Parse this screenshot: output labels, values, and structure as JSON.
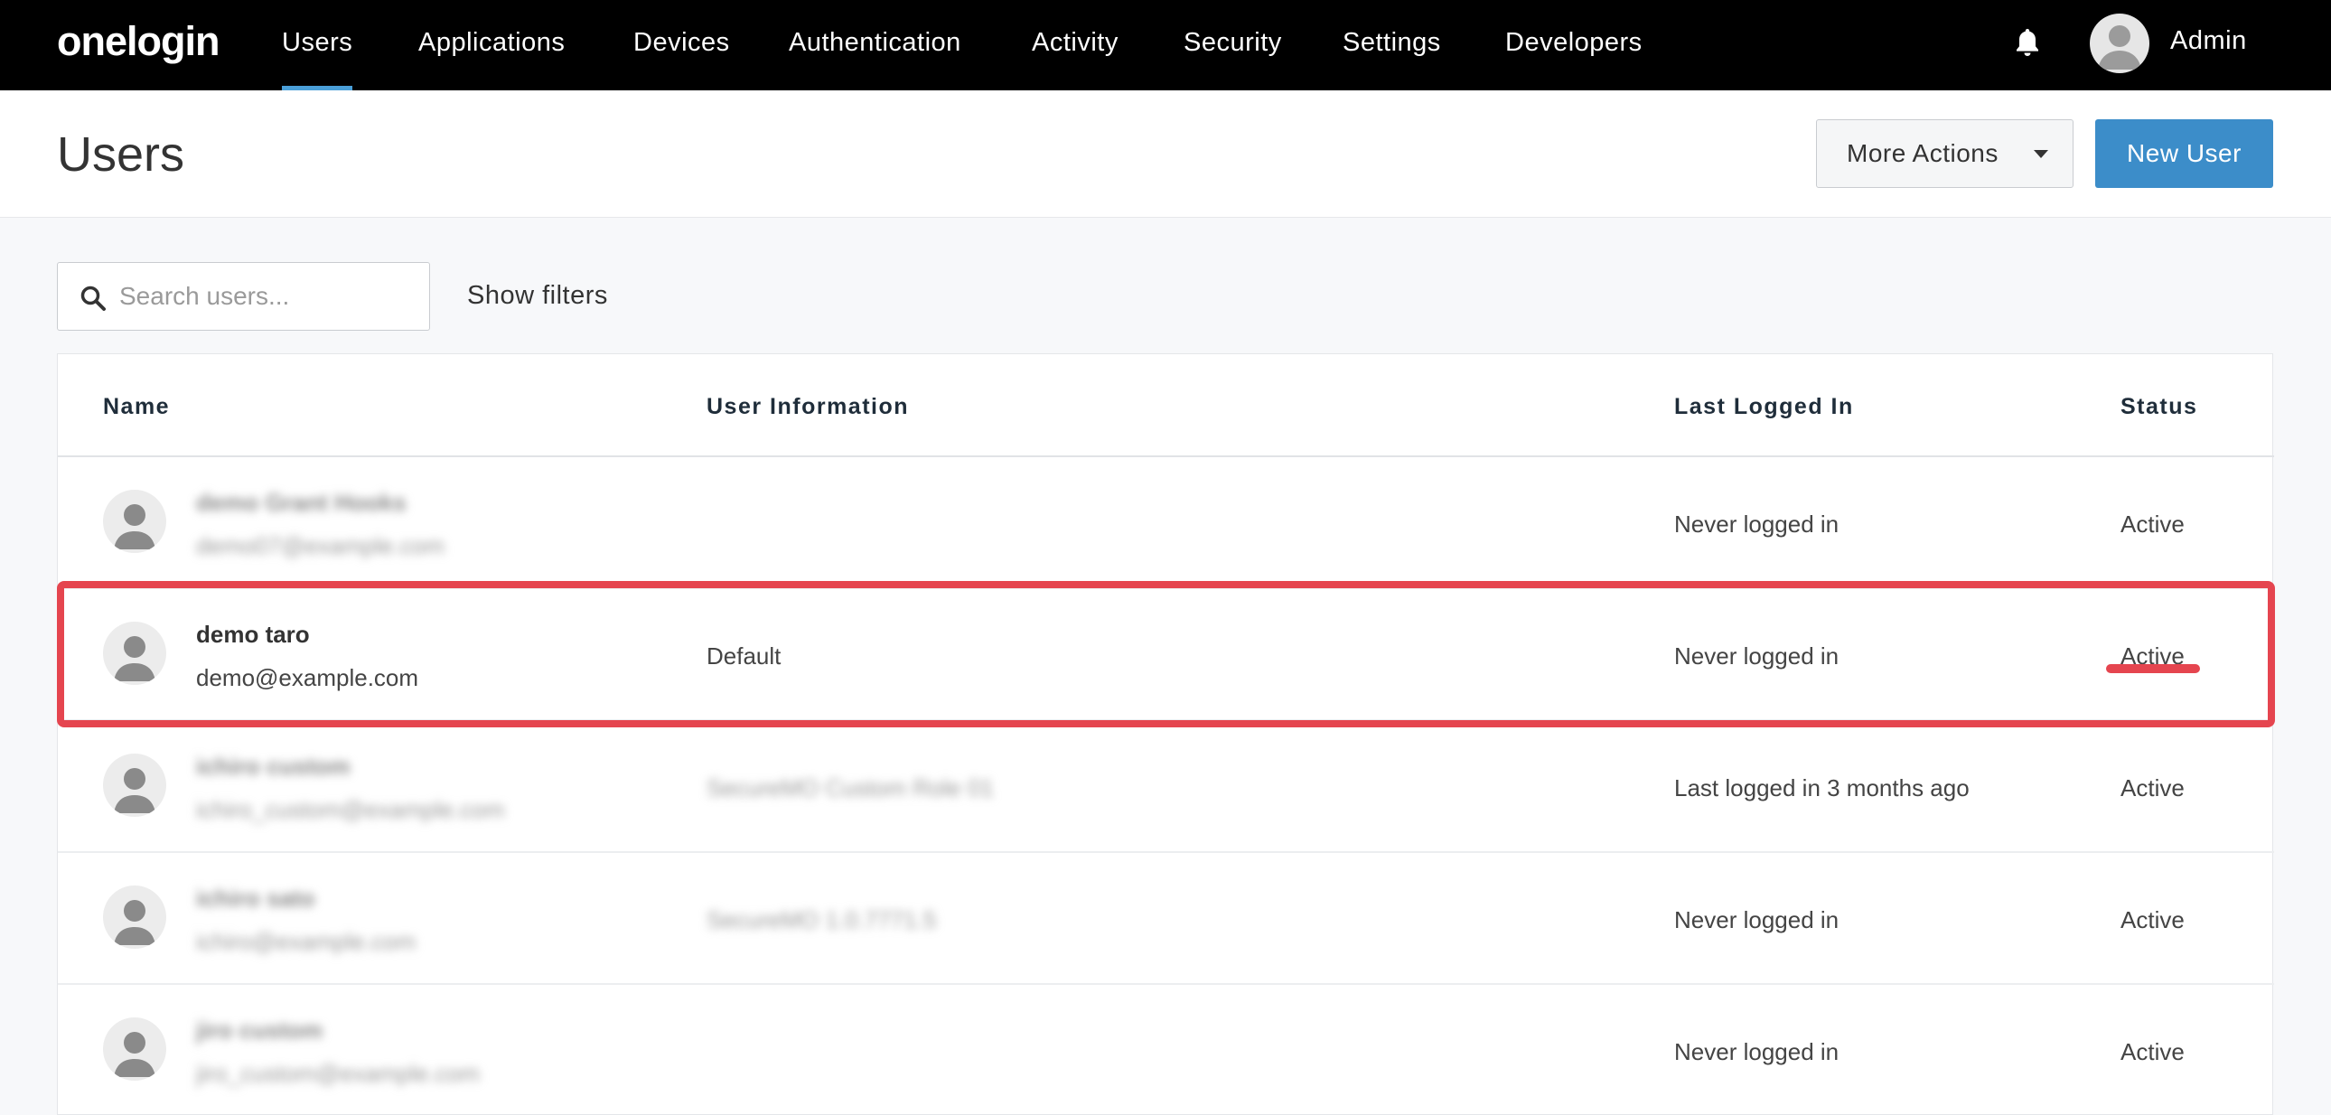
{
  "nav": {
    "logo": "onelogin",
    "items": [
      {
        "label": "Users",
        "active": true
      },
      {
        "label": "Applications"
      },
      {
        "label": "Devices"
      },
      {
        "label": "Authentication"
      },
      {
        "label": "Activity"
      },
      {
        "label": "Security"
      },
      {
        "label": "Settings"
      },
      {
        "label": "Developers"
      }
    ],
    "account_label": "Admin"
  },
  "header": {
    "title": "Users",
    "more_actions_label": "More Actions",
    "new_user_label": "New User"
  },
  "search": {
    "placeholder": "Search users...",
    "value": "",
    "show_filters_label": "Show filters"
  },
  "table": {
    "columns": [
      "Name",
      "User Information",
      "Last Logged In",
      "Status"
    ],
    "rows": [
      {
        "name": "demo Grant Hooks",
        "email": "demo07@example.com",
        "info": "",
        "last_logged_in": "Never logged in",
        "status": "Active",
        "redacted": true
      },
      {
        "name": "demo taro",
        "email": "demo@example.com",
        "info": "Default",
        "last_logged_in": "Never logged in",
        "status": "Active",
        "highlighted": true
      },
      {
        "name": "ichiro custom",
        "email": "ichiro_custom@example.com",
        "info": "SecureMO Custom Role 01",
        "last_logged_in": "Last logged in 3 months ago",
        "status": "Active",
        "redacted": true
      },
      {
        "name": "ichiro sato",
        "email": "ichiro@example.com",
        "info": "SecureMO 1.0.7771.5",
        "last_logged_in": "Never logged in",
        "status": "Active",
        "redacted": true
      },
      {
        "name": "jiro custom",
        "email": "jiro_custom@example.com",
        "info": "",
        "last_logged_in": "Never logged in",
        "status": "Active",
        "redacted": true
      }
    ]
  },
  "colors": {
    "nav_background": "#000000",
    "active_tab_accent": "#4a9fd8",
    "primary_button": "#3c8dc9",
    "highlight": "#e5454f"
  }
}
